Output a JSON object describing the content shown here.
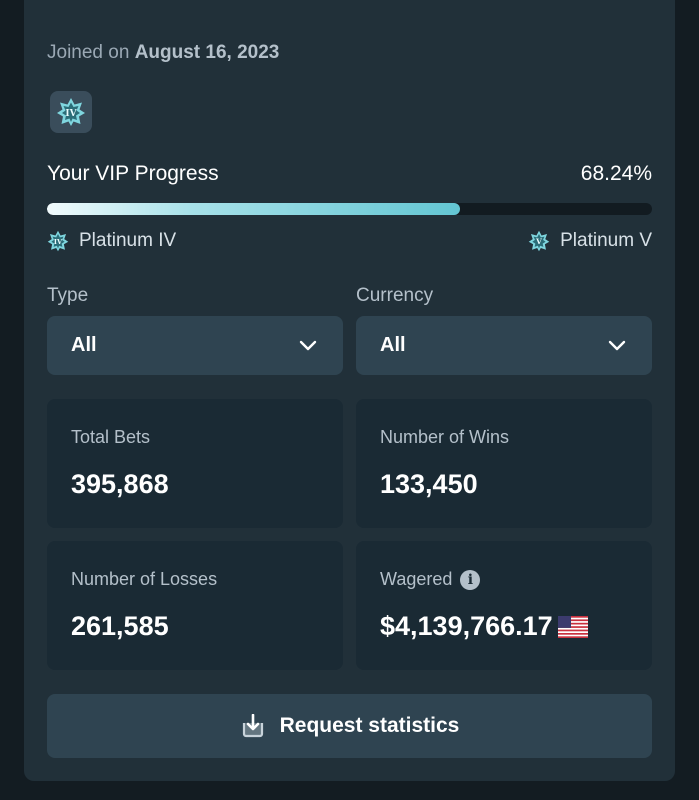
{
  "profile": {
    "joined_prefix": "Joined on",
    "joined_date": "August 16, 2023",
    "vip_badge_text": "IV"
  },
  "vip": {
    "title": "Your VIP Progress",
    "progress_label": "68.24%",
    "progress_fraction": 0.6824,
    "current_tier": "Platinum IV",
    "current_tier_badge": "IV",
    "next_tier": "Platinum V",
    "next_tier_badge": "V"
  },
  "filters": {
    "type_label": "Type",
    "type_value": "All",
    "currency_label": "Currency",
    "currency_value": "All"
  },
  "stats": {
    "total_bets_label": "Total Bets",
    "total_bets_value": "395,868",
    "wins_label": "Number of Wins",
    "wins_value": "133,450",
    "losses_label": "Number of Losses",
    "losses_value": "261,585",
    "wagered_label": "Wagered",
    "wagered_value": "$4,139,766.17",
    "wagered_currency_icon": "us-flag-icon"
  },
  "actions": {
    "request_statistics_label": "Request statistics"
  },
  "colors": {
    "panel_bg": "#213039",
    "page_bg": "#131c22",
    "card_bg": "#1a2a34",
    "control_bg": "#2f4451",
    "progress_accent": "#63c6d3"
  }
}
